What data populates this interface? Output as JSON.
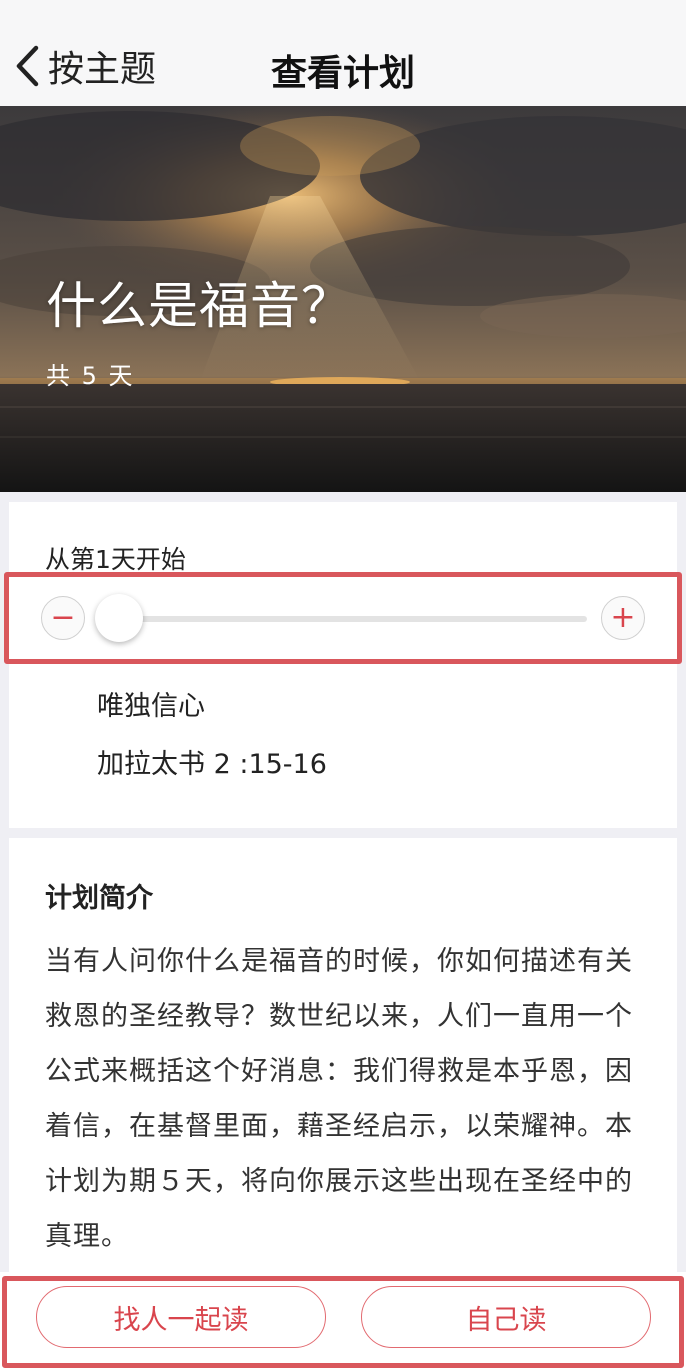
{
  "navbar": {
    "back_label": "按主题",
    "title": "查看计划"
  },
  "plan": {
    "title": "什么是福音？",
    "duration": "共 5 天"
  },
  "day_picker": {
    "start_label": "从第1天开始",
    "minus_symbol": "−",
    "plus_symbol": "+",
    "slider_position": 0,
    "reading_title": "唯独信心",
    "reading_reference": "加拉太书 2 :15-16"
  },
  "intro": {
    "heading": "计划简介",
    "body": "当有人问你什么是福音的时候，你如何描述有关救恩的圣经教导？数世纪以来，人们一直用一个公式来概括这个好消息：我们得救是本乎恩，因着信，在基督里面，藉圣经启示，以荣耀神。本计划为期５天，将向你展示这些出现在圣经中的真理。"
  },
  "actions": {
    "read_with_friends": "找人一起读",
    "read_solo": "自己读"
  },
  "colors": {
    "accent": "#d9454d",
    "highlight_outline": "#d9575c",
    "page_background": "#efeff4"
  },
  "icons": {
    "back": "chevron-left-icon"
  }
}
